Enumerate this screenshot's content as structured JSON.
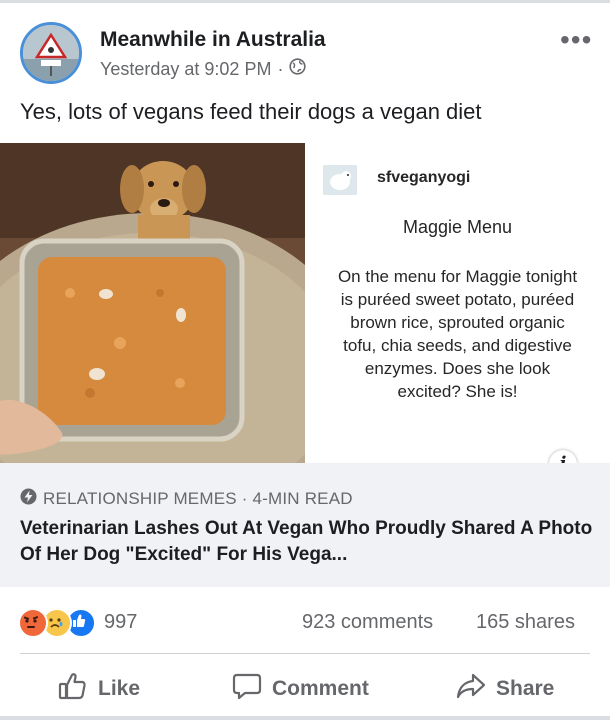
{
  "post": {
    "page_name": "Meanwhile in Australia",
    "time": "Yesterday at 9:02 PM",
    "separator": "·",
    "caption": "Yes, lots of vegans feed their dogs a vegan diet"
  },
  "image": {
    "card_username": "sfveganyogi",
    "card_title": "Maggie Menu",
    "card_body": "On the menu for Maggie tonight is puréed sweet potato, puréed brown rice, sprouted organic tofu, chia seeds, and digestive enzymes. Does she look excited? She is!",
    "info_glyph": "i"
  },
  "link_preview": {
    "source": "RELATIONSHIP MEMES · 4-MIN READ",
    "title": "Veterinarian Lashes Out At Vegan Who Proudly Shared A Photo Of Her Dog \"Excited\" For His Vega..."
  },
  "stats": {
    "reaction_icons": [
      "angry-icon",
      "sad-icon",
      "like-icon"
    ],
    "reaction_count": "997",
    "comments": "923 comments",
    "shares": "165 shares"
  },
  "actions": {
    "like": "Like",
    "comment": "Comment",
    "share": "Share"
  },
  "colors": {
    "facebook_blue": "#1877f2",
    "secondary_text": "#65676b",
    "link_box_bg": "#f0f2f5",
    "angry": "#f0683a",
    "sad": "#f7c64a"
  }
}
